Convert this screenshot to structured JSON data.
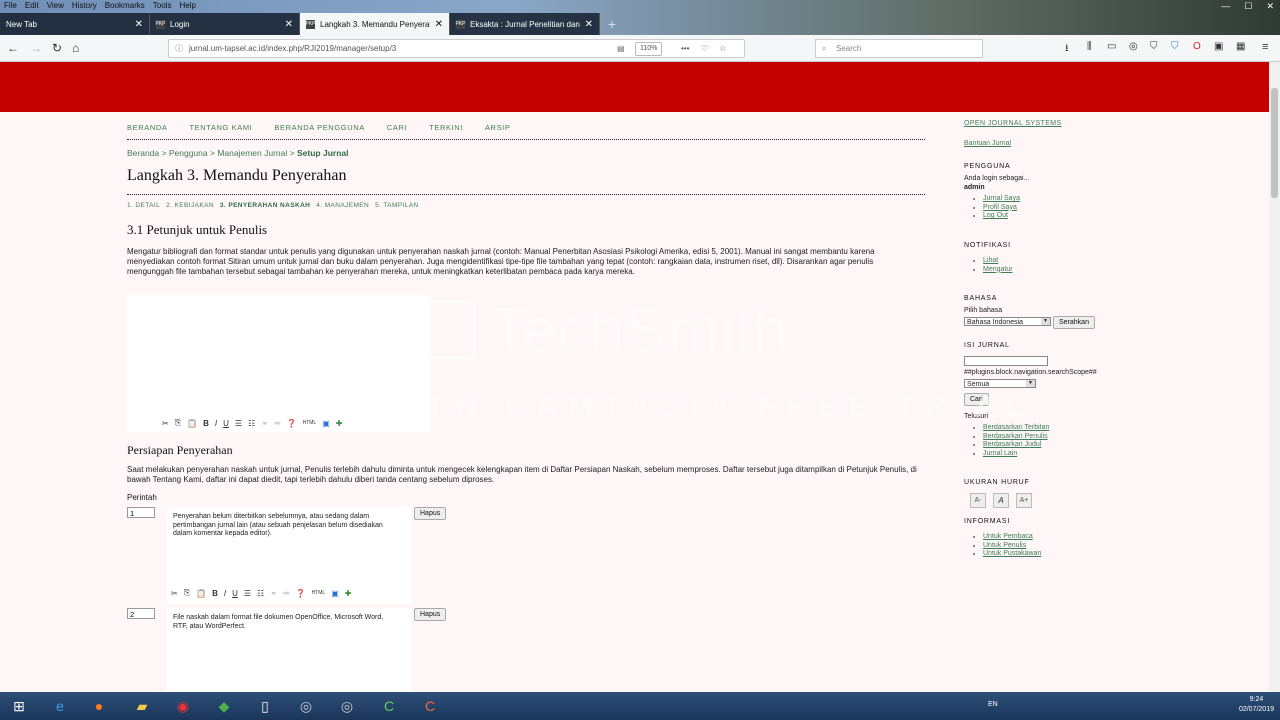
{
  "browser": {
    "menu": [
      "File",
      "Edit",
      "View",
      "History",
      "Bookmarks",
      "Tools",
      "Help"
    ],
    "tabs": [
      {
        "label": "New Tab",
        "fav": ""
      },
      {
        "label": "Login",
        "fav": "PKP"
      },
      {
        "label": "Langkah 3. Memandu Penyerah",
        "fav": "PKP"
      },
      {
        "label": "Eksakta : Jurnal Penelitian dan P",
        "fav": "PKP"
      }
    ],
    "url": "jurnal.um-tapsel.ac.id/index.php/RJI2019/manager/setup/3",
    "zoom": "110%",
    "search_placeholder": "Search"
  },
  "site_nav": [
    "BERANDA",
    "TENTANG KAMI",
    "BERANDA PENGGUNA",
    "CARI",
    "TERKINI",
    "ARSIP"
  ],
  "breadcrumb": {
    "items": [
      "Beranda",
      "Pengguna",
      "Manajemen Jurnal"
    ],
    "sep": ">",
    "current": "Setup Jurnal"
  },
  "page_title": "Langkah 3. Memandu Penyerahan",
  "steps": [
    "1. DETAIL",
    "2. KEBIJAKAN",
    "3. PENYERAHAN NASKAH",
    "4. MANAJEMEN",
    "5. TAMPILAN"
  ],
  "section1": {
    "title": "3.1 Petunjuk untuk Penulis",
    "text": "Mengatur bibliografi dan format standar untuk penulis yang digunakan untuk penyerahan naskah jurnal (contoh: Manual Penerbitan Asosiasi Psikologi Amerika, edisi 5, 2001). Manual ini sangat membantu karena menyediakan contoh format Sitiran umum untuk jurnal dan buku dalam penyerahan. Juga mengidentifikasi tipe-tipe file tambahan yang tepat (contoh: rangkaian data, instrumen riset, dll). Disarankan agar penulis mengunggah file tambahan tersebut sebagai tambahan ke penyerahan mereka, untuk meningkatkan keterlibatan pembaca pada karya mereka."
  },
  "section2": {
    "title": "Persiapan Penyerahan",
    "text": "Saat melakukan penyerahan naskah untuk jurnal, Penulis terlebih dahulu diminta untuk mengecek kelengkapan item di Daftar Persiapan Naskah, sebelum memproses. Daftar tersebut juga ditampilkan di Petunjuk Penulis, di bawah Tentang Kami, daftar ini dapat diedit, tapi terlebih dahulu diberi tanda centang sebelum diproses.",
    "order_label": "Perintah",
    "delete_label": "Hapus",
    "items": [
      {
        "order": "1",
        "text": "Penyerahan belum diterbitkan sebelumnya, atau sedang dalam pertimbangan jurnal lain (atau sebuah penjelasan belum disediakan dalam komentar kepada editor)."
      },
      {
        "order": "2",
        "text": "File naskah dalam format file dokumen OpenOffice, Microsoft Word, RTF, atau WordPerfect."
      }
    ]
  },
  "editor_toolbar": {
    "bold": "B",
    "italic": "I",
    "underline": "U",
    "html": "HTML"
  },
  "sidebar": {
    "ojs": "OPEN JOURNAL SYSTEMS",
    "help": "Bantuan Jurnal",
    "user_heading": "PENGGUNA",
    "logged_as": "Anda login sebagai...",
    "username": "admin",
    "user_links": [
      "Jurnal Saya",
      "Profil Saya",
      "Log Out"
    ],
    "notif_heading": "NOTIFIKASI",
    "notif_links": [
      "Lihat",
      "Mengatur"
    ],
    "lang_heading": "BAHASA",
    "lang_label": "Pilih bahasa",
    "lang_value": "Bahasa Indonesia",
    "lang_submit": "Serahkan",
    "content_heading": "ISI JURNAL",
    "scope_label": "##plugins.block.navigation.searchScope##",
    "scope_value": "Semua",
    "search_button": "Cari",
    "browse_label": "Telusuri",
    "browse_links": [
      "Berdasarkan Terbitan",
      "Berdasarkan Penulis",
      "Berdasarkan Judul",
      "Jurnal Lain"
    ],
    "fontsize_heading": "UKURAN HURUF",
    "fontsize_buttons": [
      "A-",
      "A",
      "A+"
    ],
    "info_heading": "INFORMASI",
    "info_links": [
      "Untuk Pembaca",
      "Untuk Penulis",
      "Untuk Pustakawan"
    ]
  },
  "watermark": {
    "brand": "TechSmith",
    "tagline": "MADE WITH CAMTASIA FREE TRIAL"
  },
  "taskbar": {
    "lang": "EN",
    "time": "9:24",
    "date": "02/07/2019"
  }
}
